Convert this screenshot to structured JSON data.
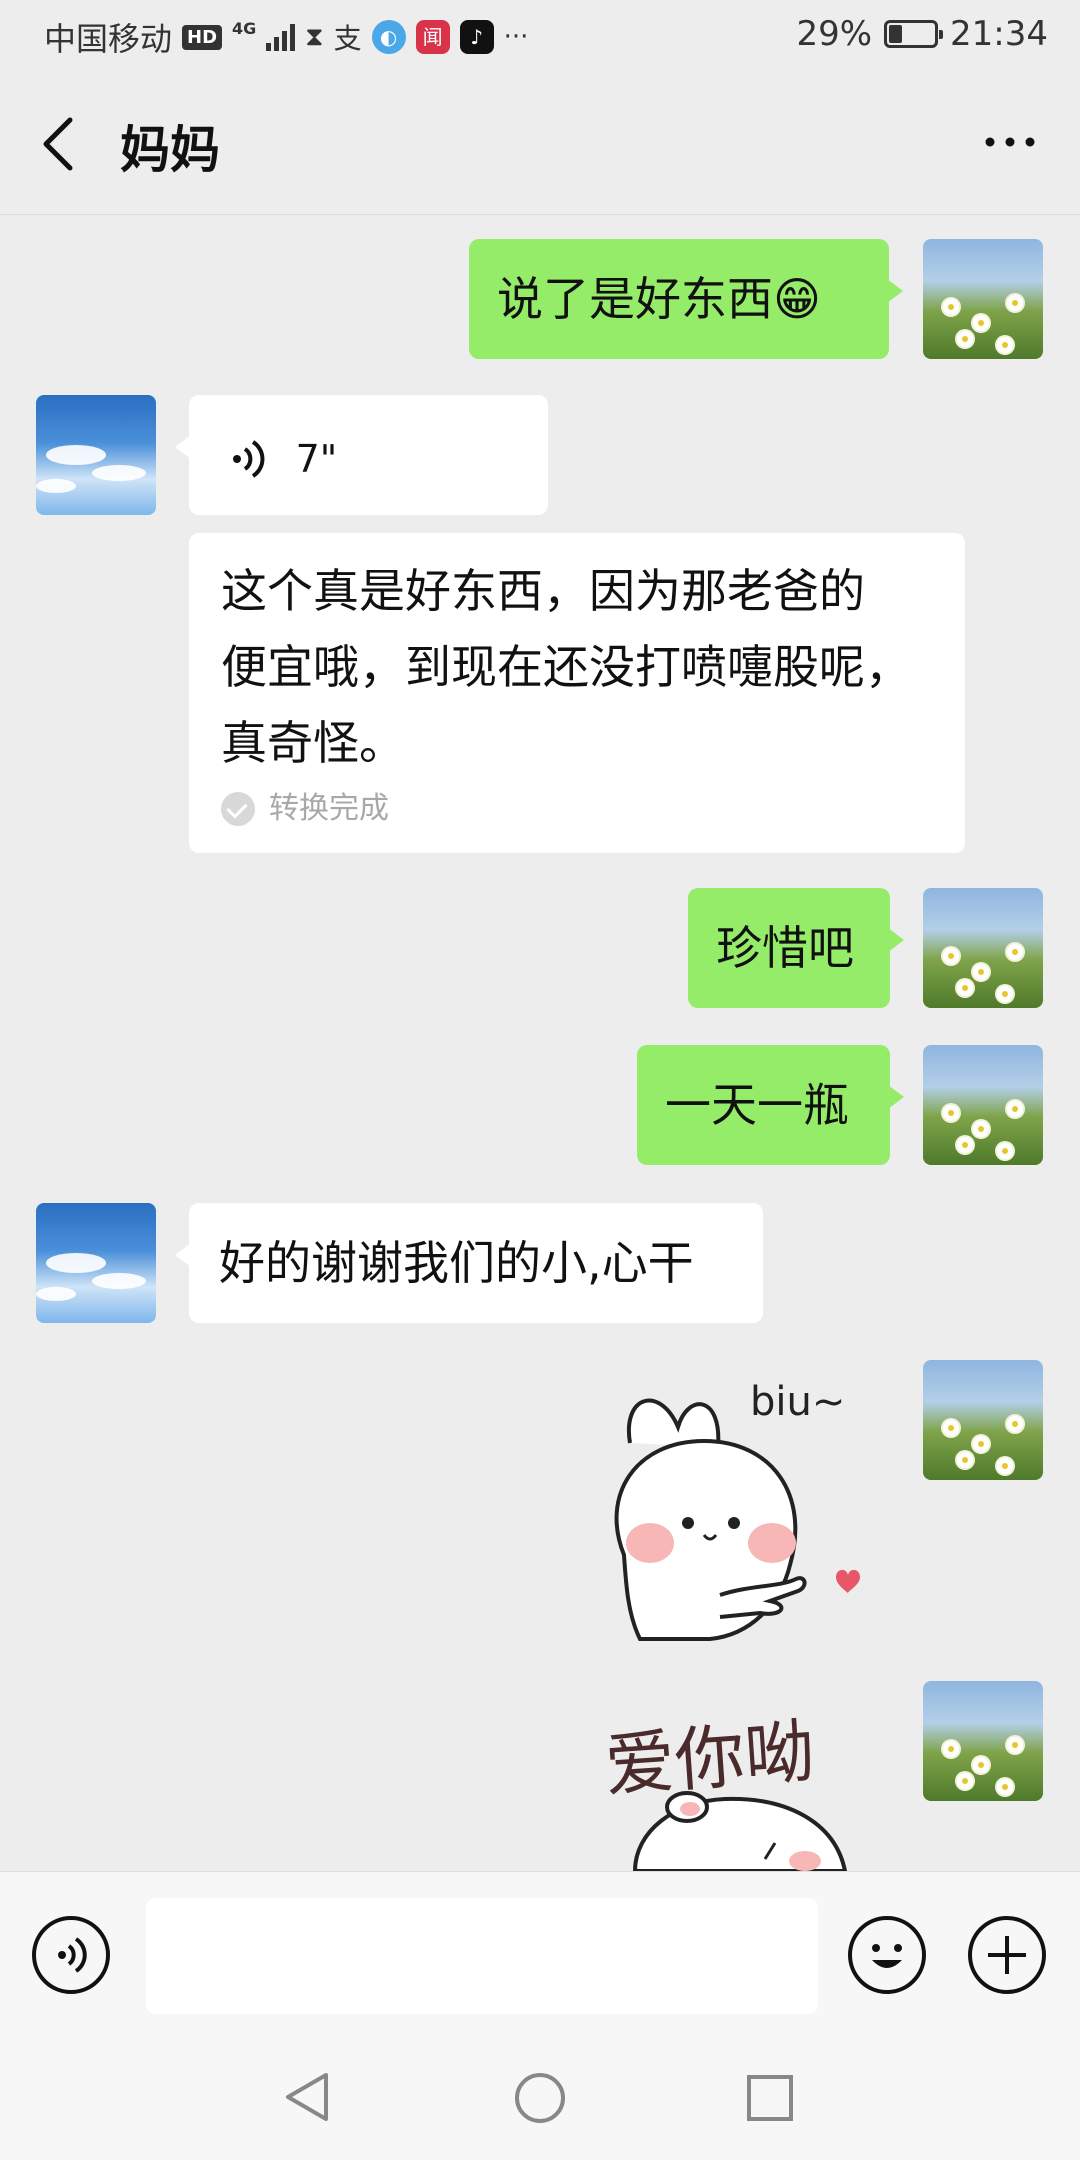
{
  "status_bar": {
    "carrier": "中国移动",
    "hd": "HD",
    "network": "4G",
    "more": "···",
    "battery": "29%",
    "battery_level": 0.29,
    "time": "21:34"
  },
  "header": {
    "title": "妈妈",
    "more_icon": "more-dots-icon"
  },
  "messages": [
    {
      "side": "right",
      "type": "text",
      "text": "说了是好东西😁"
    },
    {
      "side": "left",
      "type": "voice",
      "duration": "7\""
    },
    {
      "side": "left",
      "type": "transcription",
      "lines": [
        "这个真是好东西，因为那老爸的",
        "便宜哦，到现在还没打喷嚏股呢，",
        "真奇怪。"
      ],
      "status": "转换完成"
    },
    {
      "side": "right",
      "type": "text",
      "text": "珍惜吧"
    },
    {
      "side": "right",
      "type": "text",
      "text": "一天一瓶"
    },
    {
      "side": "left",
      "type": "text",
      "text": "好的谢谢我们的小,心干"
    },
    {
      "side": "right",
      "type": "sticker",
      "caption": "biu~"
    },
    {
      "side": "right",
      "type": "sticker",
      "caption": "爱你呦"
    }
  ],
  "input": {
    "placeholder": ""
  },
  "colors": {
    "bubble_self": "#95ec69",
    "bubble_other": "#ffffff",
    "background": "#ededed"
  }
}
